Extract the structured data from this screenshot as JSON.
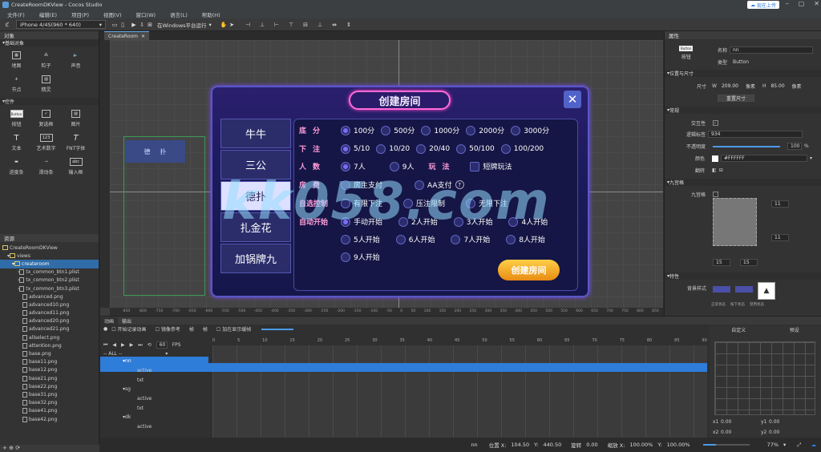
{
  "window": {
    "title": "CreateRoomDKView - Cocos Studio",
    "upload_label": "现在上传"
  },
  "menu": [
    "文件(F)",
    "编辑(E)",
    "项目(P)",
    "视图(V)",
    "窗口(W)",
    "语言(L)",
    "帮助(H)"
  ],
  "toolbar": {
    "device": "iPhone 4/4S(960 * 640)",
    "run_target": "在Windows平台运行"
  },
  "left_panel": {
    "title": "对象",
    "section1": "基础对象",
    "basic_items": [
      "地图",
      "粒子",
      "声音",
      "节点",
      "精灵"
    ],
    "section2": "控件",
    "control_items": [
      "按钮",
      "复选框",
      "图片",
      "文本",
      "艺术数字",
      "FNT字体",
      "进度条",
      "滑动条",
      "输入框"
    ],
    "button_icon_text": "Button",
    "art_num_text": "123",
    "abc_text": "abc"
  },
  "resources": {
    "title": "资源",
    "tree": [
      "CreateRoomDKView",
      "views",
      "createroom",
      "tx_common_btn1.plist",
      "tx_common_btn2.plist",
      "tx_common_btn3.plist",
      "advanced.png",
      "advanced10.png",
      "advanced11.png",
      "advanced20.png",
      "advanced21.png",
      "allselect.png",
      "attention.png",
      "base.png",
      "base11.png",
      "base12.png",
      "base21.png",
      "base22.png",
      "base31.png",
      "base32.png",
      "base41.png",
      "base42.png"
    ],
    "selected_index": 2
  },
  "doc_tab": "CreateRoom",
  "canvas": {
    "ruler_labels": [
      "-850",
      "-800",
      "-750",
      "-700",
      "-650",
      "-600",
      "-550",
      "-500",
      "-450",
      "-400",
      "-350",
      "-300",
      "-250",
      "-200",
      "-150",
      "-100",
      "-50",
      "0",
      "50",
      "100",
      "150",
      "200",
      "250",
      "300",
      "350",
      "400",
      "450",
      "500",
      "550",
      "600",
      "650",
      "700",
      "750",
      "800",
      "850"
    ],
    "dk_button": [
      "德",
      "扑"
    ]
  },
  "dialog": {
    "title": "创建房间",
    "close": "✕",
    "game_tabs": [
      "牛牛",
      "三公",
      "德扑",
      "扎金花",
      "加锅牌九"
    ],
    "active_tab": 2,
    "rows": [
      {
        "label": "底分",
        "options": [
          "100分",
          "500分",
          "1000分",
          "2000分",
          "3000分"
        ],
        "selected": 0
      },
      {
        "label": "下注",
        "options": [
          "5/10",
          "10/20",
          "20/40",
          "50/100",
          "100/200"
        ],
        "selected": 0
      },
      {
        "label": "人数",
        "options": [
          "7人",
          "9人"
        ],
        "selected": 0,
        "extra_label": "玩法",
        "extra_check": "短牌玩法"
      },
      {
        "label": "房费",
        "options": [
          "房主支付",
          "AA支付"
        ],
        "selected": -1,
        "help": "?"
      },
      {
        "label": "自选控制",
        "options": [
          "有限下注",
          "压注限制",
          "无限下注"
        ],
        "selected": -1
      },
      {
        "label": "自动开始",
        "options": [
          "手动开始",
          "2人开始",
          "3人开始",
          "4人开始",
          "5人开始",
          "6人开始",
          "7人开始",
          "8人开始",
          "9人开始"
        ],
        "selected": 0
      }
    ],
    "create_button": "创建房间"
  },
  "watermark": "kk058.com",
  "properties": {
    "title": "属性",
    "widget_label": "按钮",
    "widget_icon": "Button",
    "name_label": "名称",
    "name_value": "nn",
    "type_label": "类型",
    "type_value": "Button",
    "pos_section": "位置与尺寸",
    "size_label": "尺寸",
    "w_label": "W",
    "w_value": "209.00",
    "h_label": "H",
    "h_value": "85.00",
    "unit": "像素",
    "reset_size": "重置尺寸",
    "general_section": "常规",
    "interactive_label": "交互性",
    "tag_label": "逻辑标签",
    "tag_value": "934",
    "opacity_label": "不透明度",
    "opacity_value": "100",
    "opacity_unit": "%",
    "color_label": "颜色",
    "color_value": "#FFFFFF",
    "flip_label": "翻转",
    "nine_section": "九宫格",
    "nine_label": "九宫格",
    "nine_values": [
      "11",
      "11",
      "15",
      "15"
    ],
    "feature_section": "特性",
    "bg_style_label": "背景样式",
    "bg_states": [
      "正常状态",
      "按下状态",
      "禁用状态"
    ]
  },
  "timeline": {
    "tabs": [
      "动画",
      "输出"
    ],
    "record_label": "开始记录动画",
    "mirror_label": "镜像参考",
    "frame_label": "帧",
    "fps": "60",
    "fps_unit": "FPS",
    "all_label": "-- ALL --",
    "add_label": "加在显示缓帧",
    "frame_numbers": [
      "0",
      "5",
      "10",
      "15",
      "20",
      "25",
      "30",
      "35",
      "40",
      "45",
      "50",
      "55",
      "60",
      "65",
      "70",
      "75",
      "80",
      "85",
      "90"
    ],
    "tree": [
      "nn",
      "active",
      "txt",
      "sg",
      "active",
      "txt",
      "dk",
      "active"
    ],
    "curve_tabs": [
      "自定义",
      "预设"
    ],
    "curve_coords": [
      "x1",
      "0.00",
      "y1",
      "0.00",
      "x2",
      "0.00",
      "y2",
      "0.00"
    ]
  },
  "status": {
    "node": "nn",
    "pos_label": "位置 X:",
    "pos_x": "104.50",
    "pos_y_label": "Y:",
    "pos_y": "440.50",
    "rot_label": "旋转",
    "rot": "0.00",
    "scale_label": "缩放 X:",
    "scale_x": "100.00%",
    "scale_y_label": "Y:",
    "scale_y": "100.00%",
    "zoom": "77%"
  },
  "colors": {
    "accent": "#2e7dd8",
    "dialog_border": "#5a57c9",
    "label_pink": "#ff9ed8",
    "create_btn": "#f0a623"
  }
}
